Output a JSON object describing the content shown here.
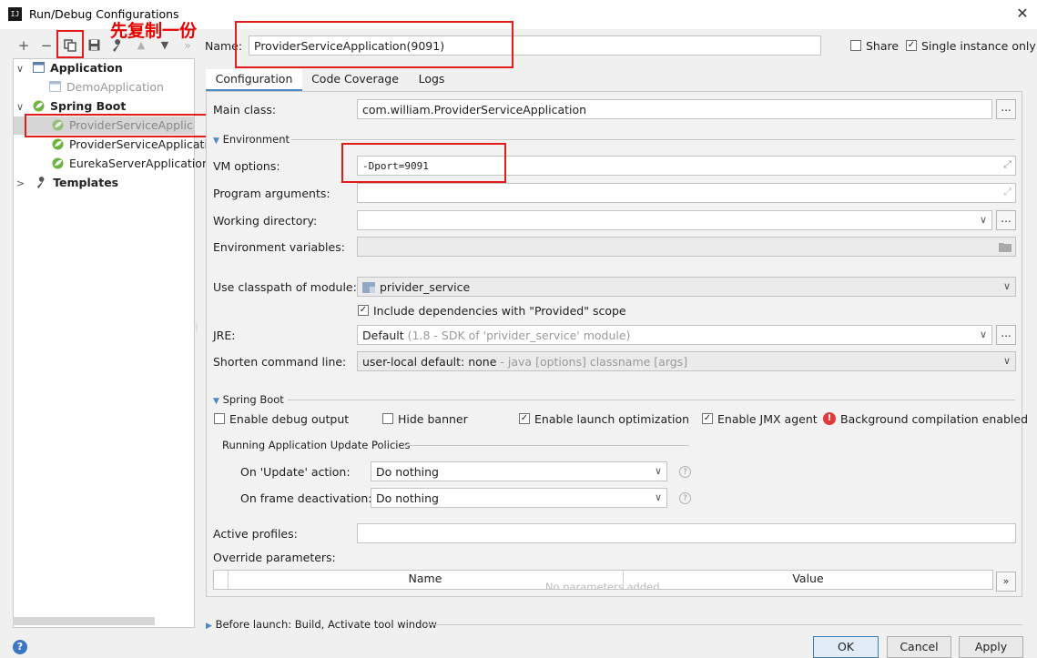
{
  "window": {
    "title": "Run/Debug Configurations",
    "app_icon": "intellij-icon",
    "close": "✕"
  },
  "toolbar": {
    "add": "+",
    "remove": "−",
    "copy": "copy-icon",
    "save": "save-icon",
    "edit_defaults": "wrench-icon",
    "move_up": "▲",
    "move_down": "▼",
    "more": "»"
  },
  "annotation": {
    "text": "先复制一份",
    "color": "#e31b1b"
  },
  "tree": {
    "application": {
      "label": "Application",
      "children": [
        "DemoApplication"
      ]
    },
    "spring_boot": {
      "label": "Spring Boot",
      "children": [
        "ProviderServiceApplication",
        "ProviderServiceApplication",
        "EurekaServerApplication"
      ]
    },
    "templates": {
      "label": "Templates"
    }
  },
  "header": {
    "name_label": "Name:",
    "name_value": "ProviderServiceApplication(9091)",
    "share_label": "Share",
    "share_checked": false,
    "single_instance_label": "Single instance only",
    "single_instance_checked": true
  },
  "tabs": [
    {
      "label": "Configuration",
      "active": true
    },
    {
      "label": "Code Coverage",
      "active": false
    },
    {
      "label": "Logs",
      "active": false
    }
  ],
  "config": {
    "main_class_label": "Main class:",
    "main_class_value": "com.william.ProviderServiceApplication",
    "environment_section": "Environment",
    "vm_options_label": "VM options:",
    "vm_options_value": "-Dport=9091",
    "program_args_label": "Program arguments:",
    "program_args_value": "",
    "working_dir_label": "Working directory:",
    "working_dir_value": "",
    "env_vars_label": "Environment variables:",
    "env_vars_value": "",
    "classpath_label": "Use classpath of module:",
    "classpath_value": "privider_service",
    "include_deps_label": "Include dependencies with \"Provided\" scope",
    "include_deps_checked": true,
    "jre_label": "JRE:",
    "jre_value": "Default",
    "jre_hint": "(1.8 - SDK of 'privider_service' module)",
    "shorten_label": "Shorten command line:",
    "shorten_value": "user-local default: none",
    "shorten_hint": "- java [options] classname [args]",
    "dots": "..."
  },
  "spring_boot": {
    "section": "Spring Boot",
    "debug_output": {
      "label": "Enable debug output",
      "checked": false
    },
    "hide_banner": {
      "label": "Hide banner",
      "checked": false
    },
    "launch_opt": {
      "label": "Enable launch optimization",
      "checked": true
    },
    "jmx_agent": {
      "label": "Enable JMX agent",
      "checked": true
    },
    "bg_compilation": "Background compilation enabled",
    "policies_section": "Running Application Update Policies",
    "on_update_label": "On 'Update' action:",
    "on_update_value": "Do nothing",
    "on_frame_label": "On frame deactivation:",
    "on_frame_value": "Do nothing",
    "active_profiles_label": "Active profiles:",
    "active_profiles_value": "",
    "override_params_label": "Override parameters:",
    "override_columns": [
      "Name",
      "Value"
    ],
    "override_empty": "No parameters added.",
    "expand": "»"
  },
  "before_launch": "Before launch: Build, Activate tool window",
  "buttons": {
    "ok": "OK",
    "cancel": "Cancel",
    "apply": "Apply",
    "help": "?"
  },
  "colors": {
    "accent": "#4a88c7",
    "annotation": "#e31b1b",
    "spring_green": "#6db33f"
  }
}
